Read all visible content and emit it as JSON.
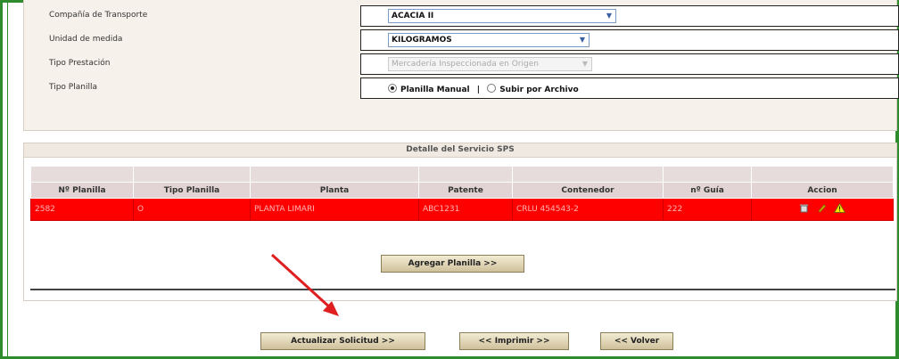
{
  "form": {
    "transport_company_label": "Compañía de Transporte",
    "transport_company_value": "ACACIA II",
    "unit_label": "Unidad de medida",
    "unit_value": "KILOGRAMOS",
    "service_type_label": "Tipo Prestación",
    "service_type_value": "Mercadería Inspeccionada en Origen",
    "form_type_label": "Tipo Planilla",
    "option_manual": "Planilla Manual",
    "option_separator": "|",
    "option_file": "Subir por Archivo"
  },
  "detail": {
    "title": "Detalle del Servicio SPS",
    "columns": [
      "Nº Planilla",
      "Tipo Planilla",
      "Planta",
      "Patente",
      "Contenedor",
      "nº Guía",
      "Accion"
    ],
    "row": {
      "planilla": "2582",
      "tipo": "O",
      "planta": "PLANTA LIMARI",
      "patente": "ABC1231",
      "contenedor": "CRLU 454543-2",
      "guia": "222"
    },
    "add_button": "Agregar Planilla >>"
  },
  "buttons": {
    "update": "Actualizar Solicitud >>",
    "print": "<< Imprimir >>",
    "back": "<< Volver"
  },
  "icons": [
    "trash-icon",
    "edit-pencil-icon",
    "warning-icon"
  ],
  "colors": {
    "frame": "#2e8b2e",
    "row_highlight": "#ff0000",
    "annotation_arrow": "#e02020"
  }
}
